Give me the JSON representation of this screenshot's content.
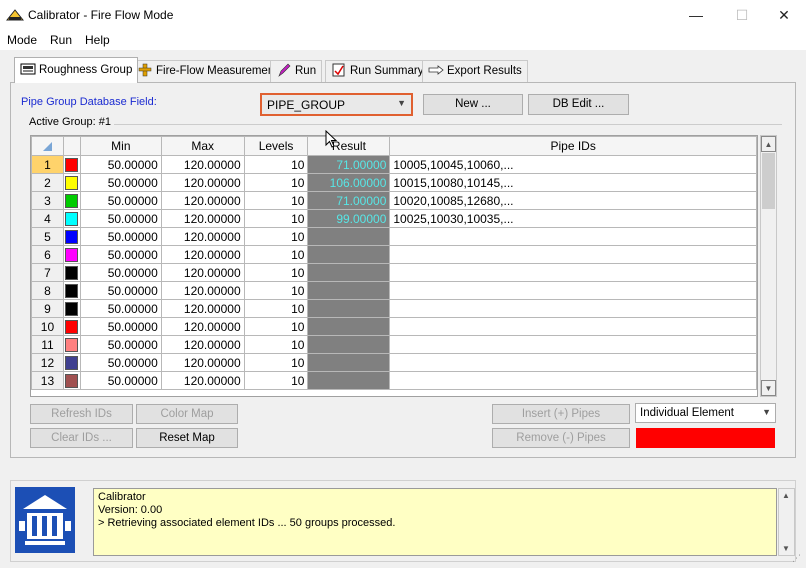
{
  "window": {
    "title": "Calibrator - Fire Flow Mode",
    "minimize": "—",
    "maximize": "☐",
    "close": "✕"
  },
  "menu": [
    "Mode",
    "Run",
    "Help"
  ],
  "tabs": [
    {
      "label": "Roughness Group",
      "icon": "pipe-group-icon"
    },
    {
      "label": "Fire-Flow Measurement",
      "icon": "hydrant-icon"
    },
    {
      "label": "Run",
      "icon": "pencil-icon"
    },
    {
      "label": "Run Summary",
      "icon": "report-icon"
    },
    {
      "label": "Export Results",
      "icon": "export-hand-icon"
    }
  ],
  "panel": {
    "field_label": "Pipe Group Database Field:",
    "field_value": "PIPE_GROUP",
    "new_button": "New ...",
    "db_edit_button": "DB Edit ...",
    "active_group": "Active Group: #1"
  },
  "grid": {
    "headers": [
      "",
      "",
      "Min",
      "Max",
      "Levels",
      "Result",
      "Pipe IDs"
    ],
    "rows": [
      {
        "n": "1",
        "color": "#ff0000",
        "min": "50.00000",
        "max": "120.00000",
        "levels": "10",
        "result": "71.00000",
        "ids": "10005,10045,10060,..."
      },
      {
        "n": "2",
        "color": "#ffff00",
        "min": "50.00000",
        "max": "120.00000",
        "levels": "10",
        "result": "106.00000",
        "ids": "10015,10080,10145,..."
      },
      {
        "n": "3",
        "color": "#00cc00",
        "min": "50.00000",
        "max": "120.00000",
        "levels": "10",
        "result": "71.00000",
        "ids": "10020,10085,12680,..."
      },
      {
        "n": "4",
        "color": "#00ffff",
        "min": "50.00000",
        "max": "120.00000",
        "levels": "10",
        "result": "99.00000",
        "ids": "10025,10030,10035,..."
      },
      {
        "n": "5",
        "color": "#0000ff",
        "min": "50.00000",
        "max": "120.00000",
        "levels": "10",
        "result": "",
        "ids": ""
      },
      {
        "n": "6",
        "color": "#ff00ff",
        "min": "50.00000",
        "max": "120.00000",
        "levels": "10",
        "result": "",
        "ids": ""
      },
      {
        "n": "7",
        "color": "#000000",
        "min": "50.00000",
        "max": "120.00000",
        "levels": "10",
        "result": "",
        "ids": ""
      },
      {
        "n": "8",
        "color": "#000000",
        "min": "50.00000",
        "max": "120.00000",
        "levels": "10",
        "result": "",
        "ids": ""
      },
      {
        "n": "9",
        "color": "#000000",
        "min": "50.00000",
        "max": "120.00000",
        "levels": "10",
        "result": "",
        "ids": ""
      },
      {
        "n": "10",
        "color": "#ff0000",
        "min": "50.00000",
        "max": "120.00000",
        "levels": "10",
        "result": "",
        "ids": ""
      },
      {
        "n": "11",
        "color": "#ff8080",
        "min": "50.00000",
        "max": "120.00000",
        "levels": "10",
        "result": "",
        "ids": ""
      },
      {
        "n": "12",
        "color": "#404090",
        "min": "50.00000",
        "max": "120.00000",
        "levels": "10",
        "result": "",
        "ids": ""
      },
      {
        "n": "13",
        "color": "#a05050",
        "min": "50.00000",
        "max": "120.00000",
        "levels": "10",
        "result": "",
        "ids": ""
      }
    ]
  },
  "buttons": {
    "refresh_ids": "Refresh IDs",
    "color_map": "Color Map",
    "clear_ids": "Clear IDs ...",
    "reset_map": "Reset Map",
    "insert_pipes": "Insert (+) Pipes",
    "remove_pipes": "Remove (-) Pipes"
  },
  "element_mode": "Individual Element",
  "highlight_color": "#ff0000",
  "log": {
    "lines": [
      "Calibrator",
      "Version: 0.00",
      "> Retrieving associated element IDs ... 50 groups processed."
    ]
  }
}
